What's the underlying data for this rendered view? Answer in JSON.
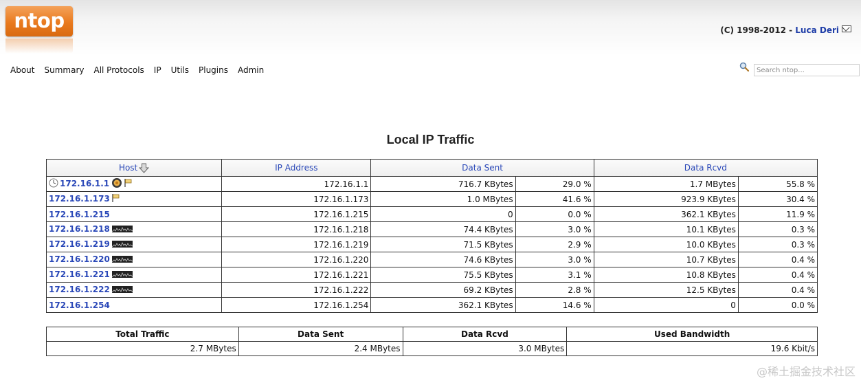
{
  "app": {
    "logo_text": "ntop",
    "copyright_prefix": "(C) 1998-2012 - ",
    "author": "Luca Deri"
  },
  "menu": [
    "About",
    "Summary",
    "All Protocols",
    "IP",
    "Utils",
    "Plugins",
    "Admin"
  ],
  "search": {
    "placeholder": "Search ntop..."
  },
  "page_title": "Local IP Traffic",
  "table": {
    "headers": {
      "host": "Host",
      "ip": "IP Address",
      "sent": "Data Sent",
      "rcvd": "Data Rcvd"
    },
    "rows": [
      {
        "host": "172.16.1.1",
        "ip": "172.16.1.1",
        "sent": "716.7 KBytes",
        "sent_pct": "29.0 %",
        "rcvd": "1.7 MBytes",
        "rcvd_pct": "55.8 %",
        "icons": [
          "clock-icon",
          "os-icon",
          "flag-icon"
        ]
      },
      {
        "host": "172.16.1.173",
        "ip": "172.16.1.173",
        "sent": "1.0 MBytes",
        "sent_pct": "41.6 %",
        "rcvd": "923.9 KBytes",
        "rcvd_pct": "30.4 %",
        "icons": [
          "flag-icon"
        ]
      },
      {
        "host": "172.16.1.215",
        "ip": "172.16.1.215",
        "sent": "0",
        "sent_pct": "0.0 %",
        "rcvd": "362.1 KBytes",
        "rcvd_pct": "11.9 %",
        "icons": []
      },
      {
        "host": "172.16.1.218",
        "ip": "172.16.1.218",
        "sent": "74.4 KBytes",
        "sent_pct": "3.0 %",
        "rcvd": "10.1 KBytes",
        "rcvd_pct": "0.3 %",
        "icons": [
          "sparkline-icon"
        ]
      },
      {
        "host": "172.16.1.219",
        "ip": "172.16.1.219",
        "sent": "71.5 KBytes",
        "sent_pct": "2.9 %",
        "rcvd": "10.0 KBytes",
        "rcvd_pct": "0.3 %",
        "icons": [
          "sparkline-icon"
        ]
      },
      {
        "host": "172.16.1.220",
        "ip": "172.16.1.220",
        "sent": "74.6 KBytes",
        "sent_pct": "3.0 %",
        "rcvd": "10.7 KBytes",
        "rcvd_pct": "0.4 %",
        "icons": [
          "sparkline-icon"
        ]
      },
      {
        "host": "172.16.1.221",
        "ip": "172.16.1.221",
        "sent": "75.5 KBytes",
        "sent_pct": "3.1 %",
        "rcvd": "10.8 KBytes",
        "rcvd_pct": "0.4 %",
        "icons": [
          "sparkline-icon"
        ]
      },
      {
        "host": "172.16.1.222",
        "ip": "172.16.1.222",
        "sent": "69.2 KBytes",
        "sent_pct": "2.8 %",
        "rcvd": "12.5 KBytes",
        "rcvd_pct": "0.4 %",
        "icons": [
          "sparkline-icon"
        ]
      },
      {
        "host": "172.16.1.254",
        "ip": "172.16.1.254",
        "sent": "362.1 KBytes",
        "sent_pct": "14.6 %",
        "rcvd": "0",
        "rcvd_pct": "0.0 %",
        "icons": []
      }
    ]
  },
  "summary": {
    "headers": {
      "total": "Total Traffic",
      "sent": "Data Sent",
      "rcvd": "Data Rcvd",
      "bandwidth": "Used Bandwidth"
    },
    "values": {
      "total": "2.7 MBytes",
      "sent": "2.4 MBytes",
      "rcvd": "3.0 MBytes",
      "bandwidth": "19.6 Kbit/s"
    }
  },
  "watermark": "@稀土掘金技术社区",
  "colors": {
    "link": "#2a48b8",
    "logo": "#e97a1e"
  }
}
